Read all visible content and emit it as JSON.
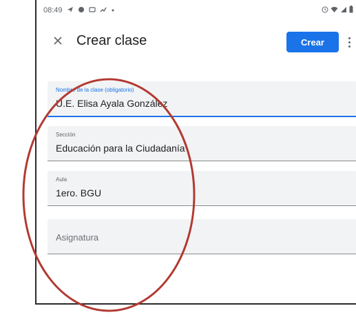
{
  "status_bar": {
    "time": "08:49",
    "left_icons": [
      "send-icon",
      "chat-icon",
      "gallery-icon",
      "activity-icon",
      "dot-icon"
    ],
    "right_icons": [
      "alarm-icon",
      "wifi-icon",
      "signal-icon",
      "battery-icon"
    ]
  },
  "app_bar": {
    "title": "Crear clase",
    "create_label": "Crear"
  },
  "form": {
    "fields": [
      {
        "label": "Nombre de la clase (obligatorio)",
        "value": "U.E. Elisa Ayala González"
      },
      {
        "label": "Sección",
        "value": "Educación para la Ciudadanía"
      },
      {
        "label": "Aula",
        "value": "1ero. BGU"
      },
      {
        "placeholder": "Asignatura"
      }
    ]
  },
  "colors": {
    "accent": "#1a73e8",
    "annotation": "#b23a32",
    "field_bg": "#f1f3f4"
  }
}
